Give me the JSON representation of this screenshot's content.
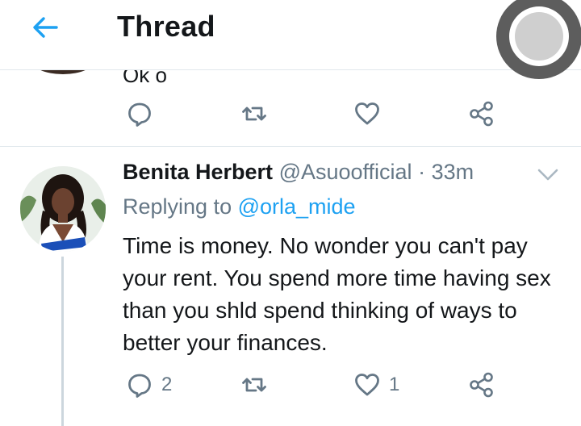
{
  "header": {
    "title": "Thread",
    "back_icon": "arrow-left-icon"
  },
  "previous_tweet": {
    "text_fragment": "Ok o"
  },
  "tweet": {
    "author_name": "Benita Herbert",
    "handle": "@Asuoofficial",
    "separator": "·",
    "time": "33m",
    "replying_label": "Replying to",
    "replying_to": "@orla_mide",
    "text": "Time is money. No wonder you can't pay your rent. You spend more time having sex than you shld spend thinking of ways to better your finances.",
    "reply_count": "2",
    "like_count": "1"
  },
  "colors": {
    "accent": "#1da1f2",
    "muted": "#657786",
    "divider": "#e1e8ed"
  }
}
